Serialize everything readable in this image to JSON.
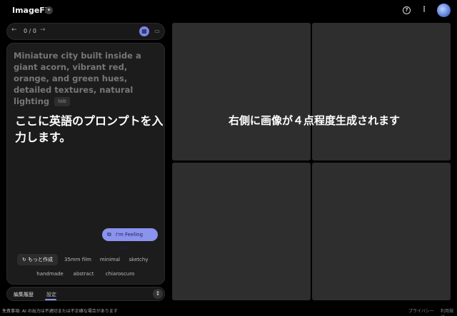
{
  "app": {
    "title": "ImageFX",
    "menu_glyph": "▾"
  },
  "header": {
    "help_glyph": "?",
    "more_glyph": "⋮"
  },
  "navigation": {
    "prev_glyph": "←",
    "counter": "0 / 0",
    "next_glyph": "→",
    "grid_view_glyph": "▦",
    "single_view_glyph": "▭"
  },
  "prompt": {
    "text": "Miniature city built inside a giant acorn, vibrant red, orange, and green hues, detailed textures, natural lighting",
    "tab_hint": "tab"
  },
  "annotations": {
    "left": "ここに英語のプロンプトを入力します。",
    "right": "右側に画像が４点程度生成されます"
  },
  "lucky_button": {
    "icon_glyph": "⧉",
    "label": "I'm Feeling Lucky"
  },
  "chips": {
    "more": {
      "icon_glyph": "↻",
      "label": "もっと作成"
    },
    "items": [
      "35mm film",
      "minimal",
      "sketchy",
      "handmade",
      "abstract",
      "chiaroscuro"
    ]
  },
  "bottom_tabs": {
    "history": "編集履歴",
    "settings": "設定",
    "expand_glyph": "⇕"
  },
  "footer": {
    "disclaimer": "免責事項: AI の出力は不適切または不正確な場合があります",
    "privacy": "プライバシー",
    "terms": "利用規約"
  },
  "colors": {
    "accent": "#8a93ee",
    "background": "#000000",
    "panel": "#1c1c1c",
    "tile": "#2e2e2e"
  }
}
